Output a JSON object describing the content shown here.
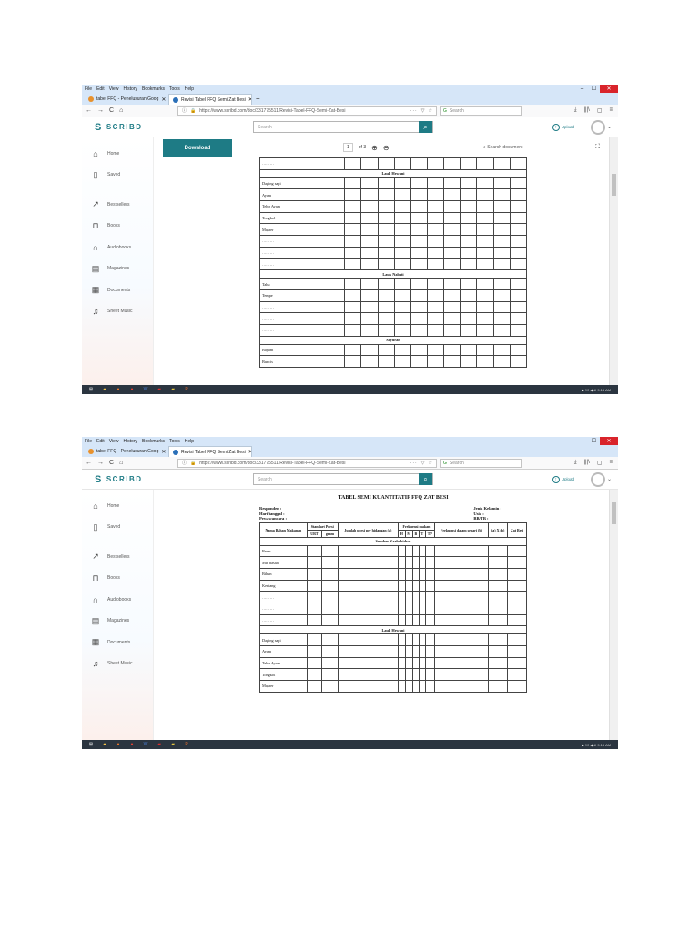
{
  "menu": [
    "File",
    "Edit",
    "View",
    "History",
    "Bookmarks",
    "Tools",
    "Help"
  ],
  "window_controls": {
    "minimize": "–",
    "maximize": "☐",
    "close": "✕"
  },
  "tabs": [
    {
      "label": "tabel FFQ - Penelusuran Goog",
      "active": false
    },
    {
      "label": "Revisi Tabel FFQ Semi Zat Besi",
      "active": true
    }
  ],
  "new_tab": "+",
  "nav": {
    "back": "←",
    "forward": "→",
    "reload": "C",
    "home": "⌂",
    "url": "https://www.scribd.com/doc/331775511/Revisi-Tabel-FFQ-Semi-Zat-Besi",
    "page_actions": "···",
    "search_placeholder": "Search",
    "download_icon": "⤓",
    "library_icon": "|||\\",
    "sidebar_icon": "▢",
    "menu_icon": "≡"
  },
  "scribd": {
    "logo": "SCRIBD",
    "search_placeholder": "Search",
    "upload": "Upload"
  },
  "sidebar": [
    {
      "label": "Home",
      "icon": "home-icon",
      "glyph": "⌂"
    },
    {
      "label": "Saved",
      "icon": "bookmark-icon",
      "glyph": "▯"
    },
    {
      "label": "Bestsellers",
      "icon": "trending-icon",
      "glyph": "↗"
    },
    {
      "label": "Books",
      "icon": "book-icon",
      "glyph": "⊓"
    },
    {
      "label": "Audiobooks",
      "icon": "headphones-icon",
      "glyph": "∩"
    },
    {
      "label": "Magazines",
      "icon": "magazine-icon",
      "glyph": "▤"
    },
    {
      "label": "Documents",
      "icon": "document-icon",
      "glyph": "▦"
    },
    {
      "label": "Sheet Music",
      "icon": "music-icon",
      "glyph": "♫"
    }
  ],
  "viewer": {
    "download": "Download",
    "page": "1",
    "of_pages": "of 3",
    "zoom_in": "⊕",
    "zoom_out": "⊖",
    "doc_search": "Search document",
    "fullscreen": "⛶"
  },
  "doc": {
    "title": "TABEL SEMI KUANTITATIF FFQ ZAT BESI",
    "meta_left": [
      "Responden    :",
      "Hari/tanggal   :",
      "Pewawancara  :"
    ],
    "meta_right": [
      "Jenis Kelamin  :",
      "Usia              :",
      "BB/TB            :"
    ],
    "headers": {
      "nama": "Nama Bahan Makanan",
      "standart": "Standart Porsi",
      "jumlah": "Jumlah porsi per hidangan (a)",
      "frekuensi": "Frekuensi makan",
      "frek_hari": "Frekuensi dalam sehari (b)",
      "axb": "(a) X (b)",
      "zat": "Zat Besi",
      "urt": "URT",
      "gram": "gram",
      "freq_cols": [
        "H",
        "M",
        "B",
        "T",
        "TP"
      ]
    },
    "sections": {
      "karbohidrat": "Sumber Karbohidrat",
      "hewani": "Lauk Hewani",
      "nabati": "Lauk Nabati",
      "sayuran": "Sayuran"
    },
    "ellipsis": "………",
    "karbo_items": [
      "Beras",
      "Mie basah",
      "Bihun",
      "Kentang"
    ],
    "hewani_items": [
      "Daging sapi",
      "Ayam",
      "Telur Ayam",
      "Tongkol",
      "Mujaer"
    ],
    "nabati_items": [
      "Tahu",
      "Tempe"
    ],
    "sayur_items": [
      "Bayam",
      "Buncis"
    ]
  },
  "taskbar": {
    "tray": "▲ ☐ ◀ ıll  9:15 AM"
  }
}
